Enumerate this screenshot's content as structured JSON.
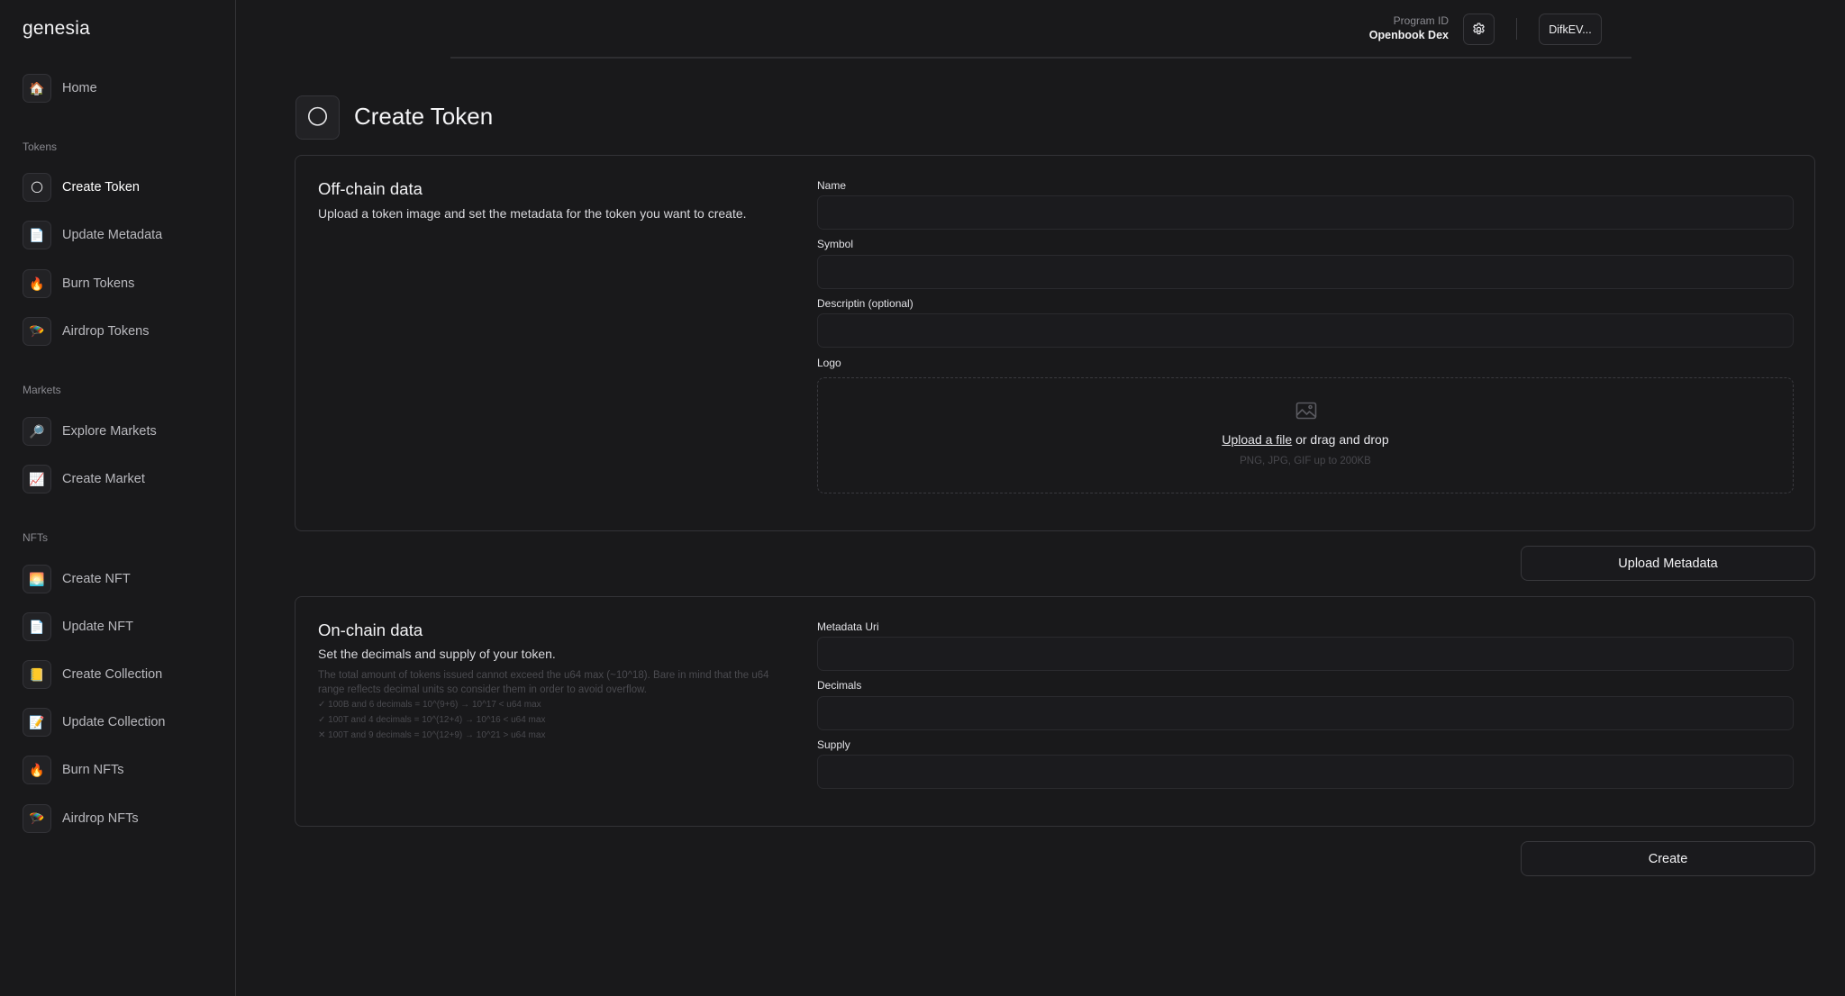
{
  "app": {
    "brand": "genesia"
  },
  "sidebar": {
    "home": {
      "label": "Home",
      "icon": "🏠"
    },
    "sections": [
      {
        "title": "Tokens",
        "items": [
          {
            "label": "Create Token",
            "icon": "🌕",
            "active": true
          },
          {
            "label": "Update Metadata",
            "icon": "📄"
          },
          {
            "label": "Burn Tokens",
            "icon": "🔥"
          },
          {
            "label": "Airdrop Tokens",
            "icon": "🪂"
          }
        ]
      },
      {
        "title": "Markets",
        "items": [
          {
            "label": "Explore Markets",
            "icon": "🔎"
          },
          {
            "label": "Create Market",
            "icon": "📈"
          }
        ]
      },
      {
        "title": "NFTs",
        "items": [
          {
            "label": "Create NFT",
            "icon": "🌅"
          },
          {
            "label": "Update NFT",
            "icon": "📄"
          },
          {
            "label": "Create Collection",
            "icon": "📒"
          },
          {
            "label": "Update Collection",
            "icon": "📝"
          },
          {
            "label": "Burn NFTs",
            "icon": "🔥"
          },
          {
            "label": "Airdrop NFTs",
            "icon": "🪂"
          }
        ]
      }
    ]
  },
  "header": {
    "program_label": "Program ID",
    "program_value": "Openbook Dex",
    "settings_icon": "gear-icon",
    "wallet_label": "DifkEV..."
  },
  "page": {
    "title": "Create Token",
    "title_icon": "🌕"
  },
  "offchain": {
    "heading": "Off-chain data",
    "subtitle": "Upload a token image and set the metadata for the token you want to create.",
    "fields": {
      "name": {
        "label": "Name",
        "value": "",
        "placeholder": ""
      },
      "symbol": {
        "label": "Symbol",
        "value": "",
        "placeholder": ""
      },
      "description": {
        "label": "Descriptin (optional)",
        "value": "",
        "placeholder": ""
      }
    },
    "logo": {
      "label": "Logo",
      "upload_link": "Upload a file",
      "upload_rest": " or drag and drop",
      "hint": "PNG, JPG, GIF up to 200KB",
      "icon": "image-icon"
    },
    "button": "Upload Metadata"
  },
  "onchain": {
    "heading": "On-chain data",
    "subtitle": "Set the decimals and supply of your token.",
    "note": "The total amount of tokens issued cannot exceed the u64 max (~10^18). Bare in mind that the u64 range reflects decimal units so consider them in order to avoid overflow.",
    "examples": [
      "✓ 100B and 6 decimals = 10^(9+6) → 10^17 < u64 max",
      "✓ 100T and 4 decimals = 10^(12+4) → 10^16 < u64 max",
      "✕ 100T and 9 decimals = 10^(12+9) → 10^21 > u64 max"
    ],
    "fields": {
      "uri": {
        "label": "Metadata Uri",
        "value": "",
        "placeholder": ""
      },
      "decimals": {
        "label": "Decimals",
        "value": "",
        "placeholder": ""
      },
      "supply": {
        "label": "Supply",
        "value": "",
        "placeholder": ""
      }
    },
    "button": "Create"
  }
}
